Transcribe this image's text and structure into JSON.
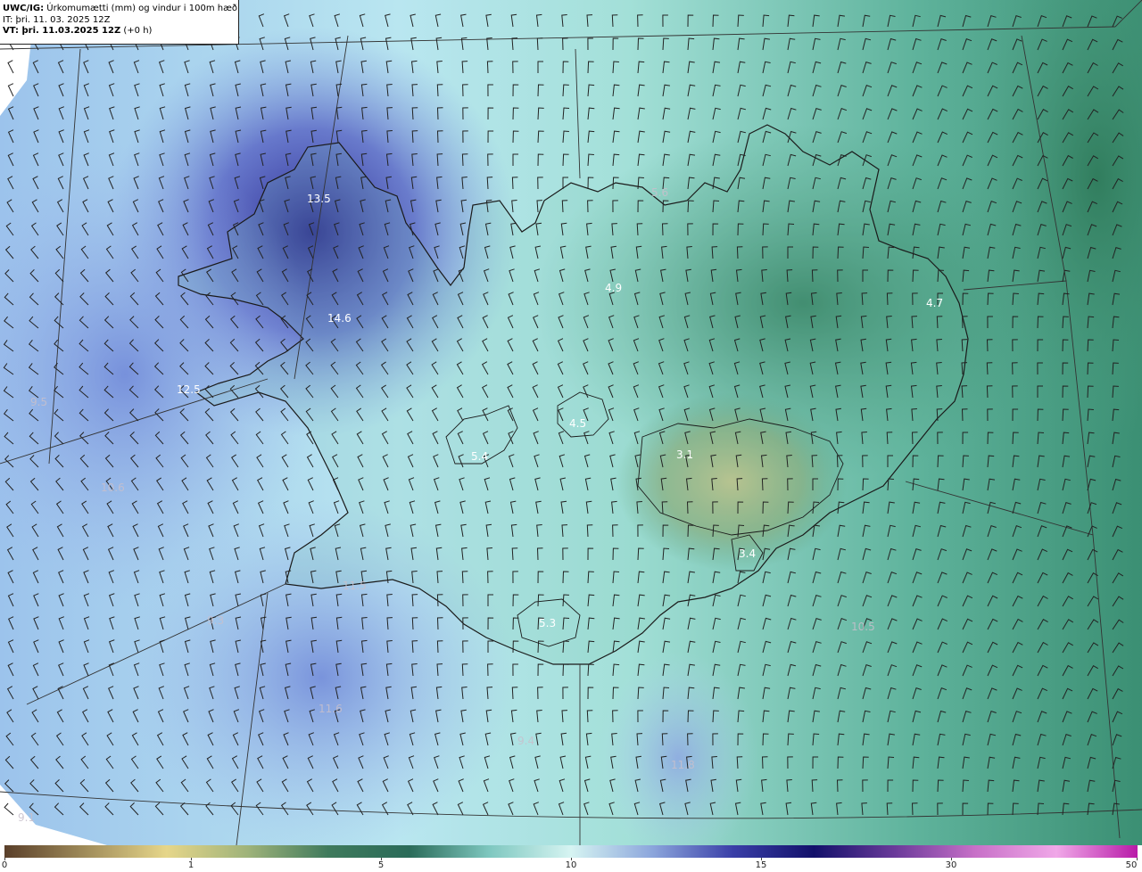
{
  "header": {
    "line1_bold": "UWC/IG:",
    "line1_text": " Úrkomumætti (mm) og vindur i 100m hæð",
    "line2": "IT: þri. 11. 03. 2025 12Z",
    "line3_bold": "VT: þri. 11.03.2025 12Z",
    "line3_text": " (+0 h)"
  },
  "map_values": [
    {
      "text": "13.5",
      "style": "bright"
    },
    {
      "text": "14.6",
      "style": "bright"
    },
    {
      "text": "12.5",
      "style": "bright"
    },
    {
      "text": "9.5",
      "style": "faint"
    },
    {
      "text": "10.6",
      "style": "faint"
    },
    {
      "text": "11.5",
      "style": "faint"
    },
    {
      "text": "9.3",
      "style": "faint"
    },
    {
      "text": "11.6",
      "style": "faint"
    },
    {
      "text": "9.4",
      "style": "faint"
    },
    {
      "text": "11.8",
      "style": "faint"
    },
    {
      "text": "10.5",
      "style": "faint"
    },
    {
      "text": "5.4",
      "style": "bright"
    },
    {
      "text": "4.5",
      "style": "bright"
    },
    {
      "text": "4.9",
      "style": "bright"
    },
    {
      "text": "4.7",
      "style": "bright"
    },
    {
      "text": "3.1",
      "style": "bright"
    },
    {
      "text": "3.4",
      "style": "bright"
    },
    {
      "text": "5.3",
      "style": "bright"
    },
    {
      "text": "9.1",
      "style": "faint"
    },
    {
      "text": "5.6",
      "style": "faint"
    }
  ],
  "colorbar": {
    "ticks": [
      "0",
      "1",
      "5",
      "10",
      "15",
      "30",
      "50"
    ],
    "colors": [
      "#5a3f2a",
      "#a08c5a",
      "#e6d68a",
      "#9fb37a",
      "#3f7a5c",
      "#2a6b59",
      "#7fc8c0",
      "#d6f4f2",
      "#8ca6dc",
      "#3a3fa8",
      "#12106a",
      "#6a3a9a",
      "#c870c8",
      "#f0a8e8",
      "#b81aa8"
    ]
  },
  "colors": {
    "land_outline": "#1a1a1a",
    "graticule": "#333333"
  }
}
